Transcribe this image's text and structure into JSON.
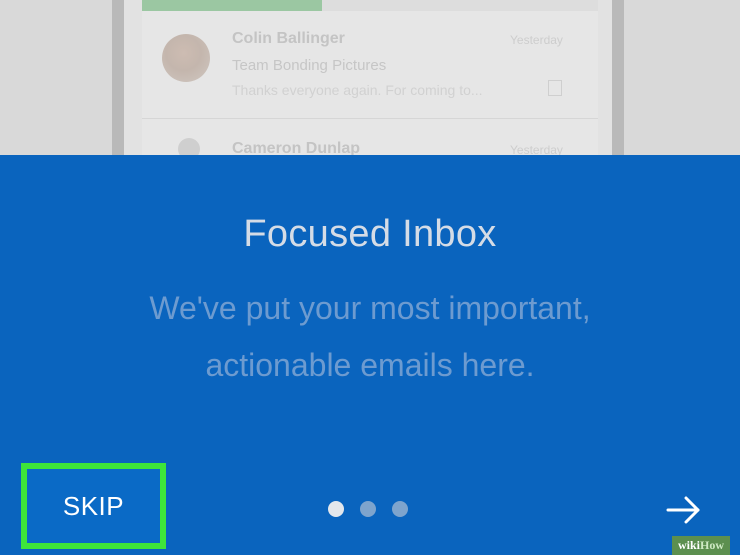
{
  "preview": {
    "email_1": {
      "sender": "Colin Ballinger",
      "date": "Yesterday",
      "subject": "Team Bonding Pictures",
      "preview": "Thanks everyone again. For coming to..."
    },
    "email_2": {
      "sender": "Cameron Dunlap",
      "date": "Yesterday"
    }
  },
  "onboarding": {
    "title": "Focused Inbox",
    "subtitle_line_1": "We've put your most important,",
    "subtitle_line_2": "actionable emails here.",
    "skip_label": "SKIP",
    "page_count": 3,
    "active_page": 1,
    "next_icon": "arrow-right-icon"
  },
  "watermark": {
    "prefix": "wiki",
    "suffix": "How"
  },
  "colors": {
    "panel_background": "#0a64be",
    "title": "#d5dce6",
    "subtitle": "#6d9bd0",
    "highlight": "#3ee53a",
    "dot_active": "#e3e7ec",
    "dot_inactive": "#7ea4cd"
  }
}
